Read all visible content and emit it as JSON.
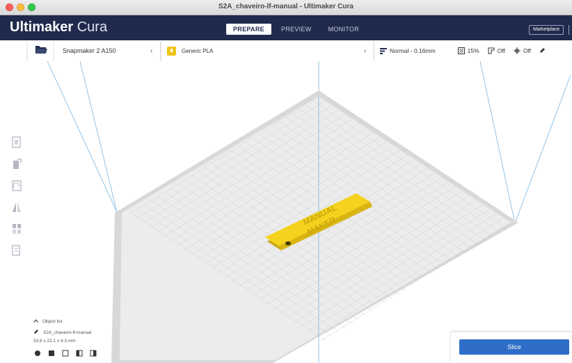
{
  "window": {
    "title": "S2A_chaveiro-lf-manual - Ultimaker Cura"
  },
  "header": {
    "brand_bold": "Ultimaker",
    "brand_light": "Cura",
    "tabs": [
      {
        "label": "PREPARE",
        "active": true
      },
      {
        "label": "PREVIEW",
        "active": false
      },
      {
        "label": "MONITOR",
        "active": false
      }
    ],
    "marketplace_label": "Marketplace"
  },
  "toolbar": {
    "printer": "Snapmaker 2 A150",
    "material": "Generic PLA",
    "profile": "Normal - 0.16mm",
    "infill": "15%",
    "support": "Off",
    "adhesion": "Off"
  },
  "left_tools": [
    "move-tool-icon",
    "scale-tool-icon",
    "rotate-tool-icon",
    "mirror-tool-icon",
    "per-model-settings-icon",
    "support-blocker-icon"
  ],
  "object_list": {
    "header": "Object list",
    "filename": "S2A_chaveiro-lf-manual",
    "dimensions": "53.8 x 22.1 x 4.3 mm"
  },
  "model": {
    "color": "#f4d21e",
    "text_line1": "MANUAL",
    "text_line2": "MAKER"
  },
  "slice": {
    "button_label": "Slice"
  },
  "colors": {
    "header_bg": "#1f2a4c",
    "accent": "#2e6ec8",
    "build_plate": "#d8d8d8"
  }
}
